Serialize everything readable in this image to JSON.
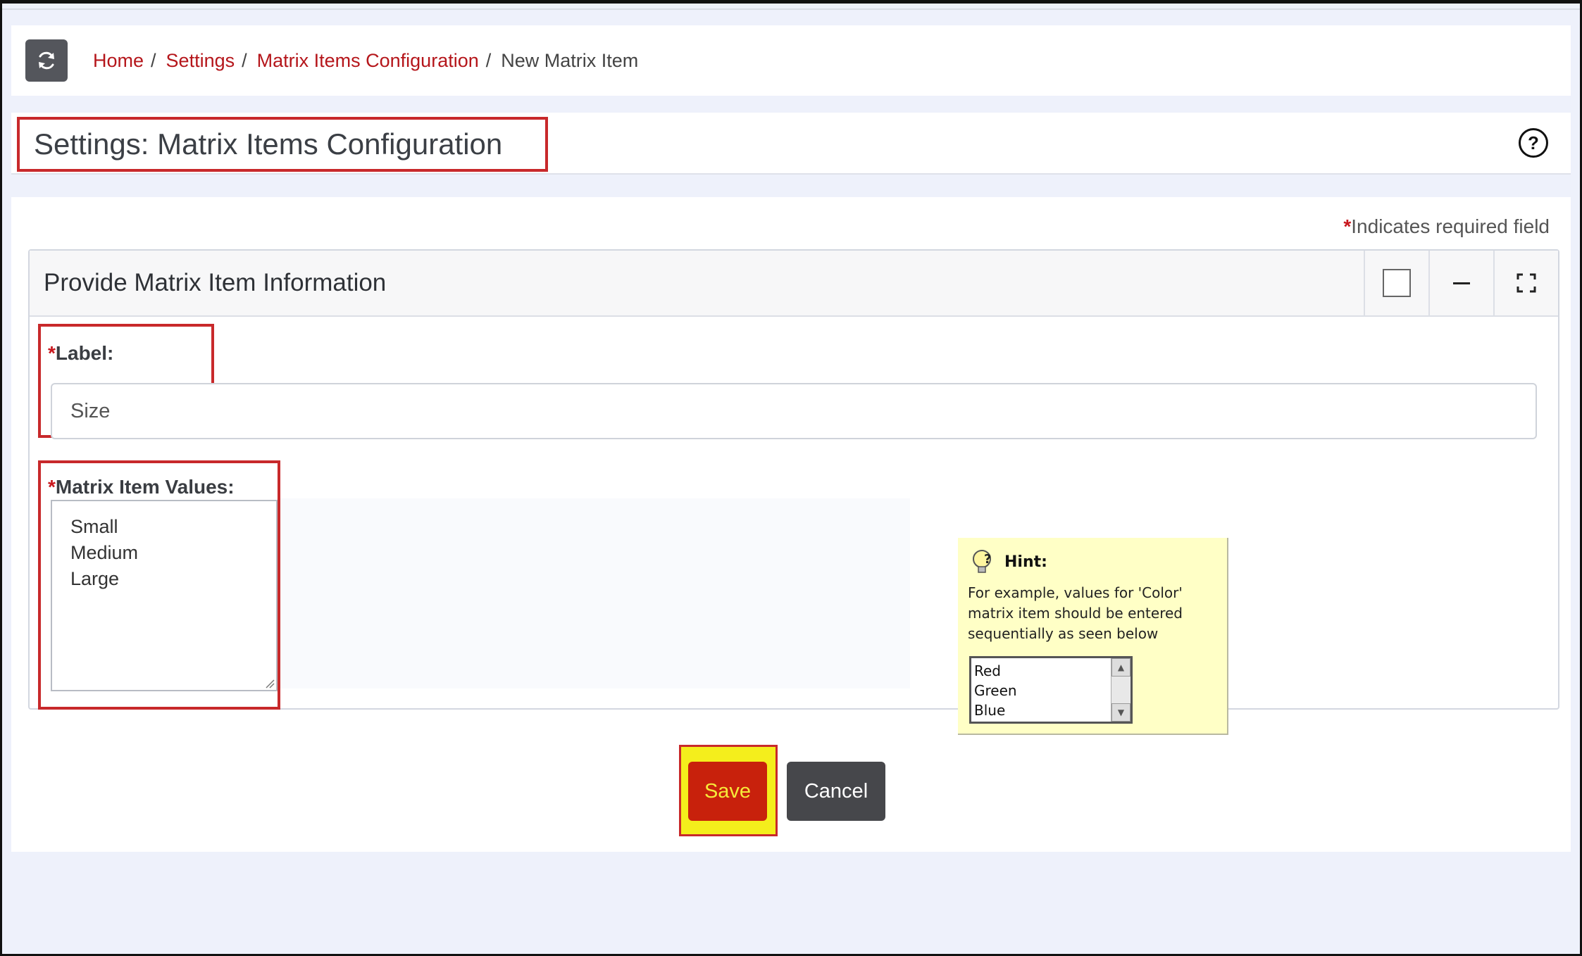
{
  "breadcrumb": {
    "items": [
      {
        "label": "Home"
      },
      {
        "label": "Settings"
      },
      {
        "label": "Matrix Items Configuration"
      }
    ],
    "separator": "/",
    "current": "New Matrix Item"
  },
  "page": {
    "title": "Settings: Matrix Items Configuration",
    "help_symbol": "?"
  },
  "form": {
    "required_star": "*",
    "required_note": "Indicates required field",
    "card_title": "Provide Matrix Item Information",
    "label_field": {
      "label": "Label:",
      "value": "Size"
    },
    "values_field": {
      "label": "Matrix Item Values:",
      "values": [
        "Small",
        "Medium",
        "Large"
      ]
    }
  },
  "hint": {
    "title": "Hint:",
    "text": "For example, values for 'Color' matrix item should be entered sequentially as seen below",
    "examples": [
      "Red",
      "Green",
      "Blue"
    ]
  },
  "buttons": {
    "save": "Save",
    "cancel": "Cancel"
  },
  "colors": {
    "accent_red": "#c8292b",
    "link_red": "#b5161b",
    "save_bg": "#c8210c",
    "highlight_yellow": "#f4ee1c"
  }
}
